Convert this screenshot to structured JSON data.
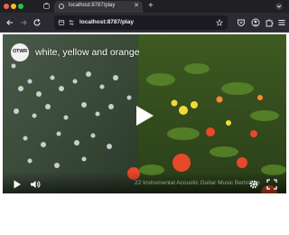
{
  "browser": {
    "tab": {
      "title": "localhost:8787/play"
    },
    "url": "localhost:8787/play"
  },
  "video": {
    "channel_logo_text": "OTWR",
    "title": "white, yellow and orange",
    "watermark": "22 Instrumental Acoustic Guitar Music Bertolt ab"
  },
  "icons": {
    "play": "play-icon",
    "volume": "volume-icon",
    "settings": "gear-icon",
    "fullscreen": "fullscreen-icon"
  }
}
